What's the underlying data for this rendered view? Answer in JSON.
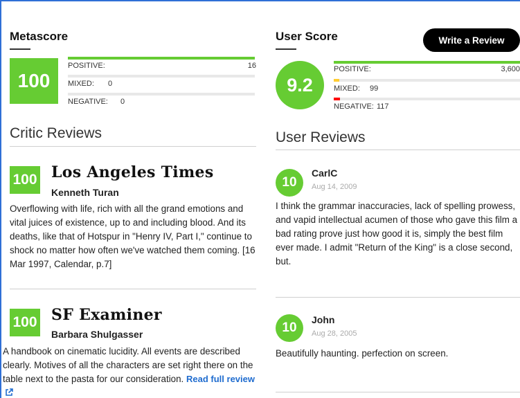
{
  "metascore": {
    "heading": "Metascore",
    "score": "100",
    "distribution": [
      {
        "label": "POSITIVE:",
        "count": "16",
        "fraction": 1.0,
        "color": "#66cc33"
      },
      {
        "label": "MIXED:",
        "count": "0",
        "fraction": 0.0,
        "color": "#ffcc33"
      },
      {
        "label": "NEGATIVE:",
        "count": "0",
        "fraction": 0.0,
        "color": "#ff0000"
      }
    ]
  },
  "userscore": {
    "heading": "User Score",
    "score": "9.2",
    "write_review_label": "Write a Review",
    "distribution": [
      {
        "label": "POSITIVE:",
        "count": "3,600",
        "fraction": 1.0,
        "color": "#66cc33"
      },
      {
        "label": "MIXED:",
        "count": "99",
        "fraction": 0.028,
        "color": "#ffcc33"
      },
      {
        "label": "NEGATIVE:",
        "count": "117",
        "fraction": 0.033,
        "color": "#ff0000"
      }
    ]
  },
  "critic_reviews": {
    "heading": "Critic Reviews",
    "read_full_label": "Read full review",
    "items": [
      {
        "score": "100",
        "publication": "Los Angeles Times",
        "critic": "Kenneth Turan",
        "text": "Overflowing with life, rich with all the grand emotions and vital juices of existence, up to and including blood. And its deaths, like that of Hotspur in \"Henry IV, Part I,\" continue to shock no matter how often we've watched them coming. [16 Mar 1997, Calendar, p.7]"
      },
      {
        "score": "100",
        "publication": "SF Examiner",
        "critic": "Barbara Shulgasser",
        "text": "A handbook on cinematic lucidity. All events are described clearly. Motives of all the characters are set right there on the table next to the pasta for our consideration."
      }
    ]
  },
  "user_reviews": {
    "heading": "User Reviews",
    "items": [
      {
        "score": "10",
        "user": "CarlC",
        "date": "Aug 14, 2009",
        "text": "I think the grammar inaccuracies, lack of spelling prowess, and vapid intellectual acumen of those who gave this film a bad rating prove just how good it is, simply the best film ever made. I admit \"Return of the King\" is a close second, but."
      },
      {
        "score": "10",
        "user": "John",
        "date": "Aug 28, 2005",
        "text": "Beautifully haunting. perfection on screen."
      }
    ]
  }
}
